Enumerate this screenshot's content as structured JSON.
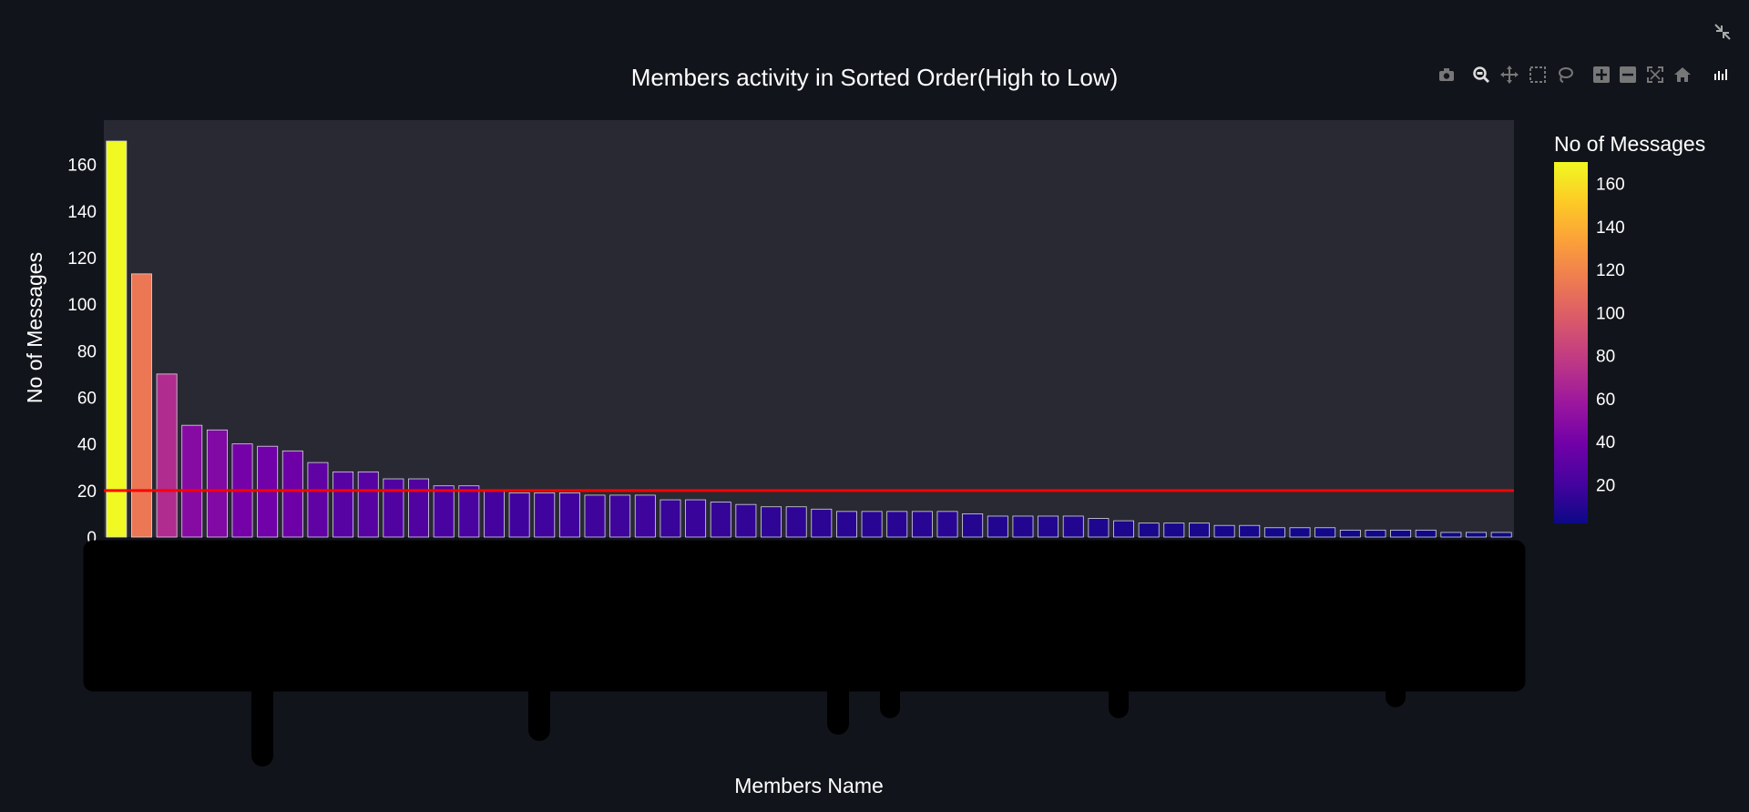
{
  "chart_data": {
    "type": "bar",
    "title": "Members activity in Sorted Order(High to Low)",
    "xlabel": "Members Name",
    "ylabel": "No of Messages",
    "ylim": [
      0,
      170
    ],
    "yticks": [
      0,
      20,
      40,
      60,
      80,
      100,
      120,
      140,
      160
    ],
    "reference_line": 20,
    "reference_line_color": "#ff0000",
    "x_tick_labels_visible": false,
    "values": [
      170,
      113,
      70,
      48,
      46,
      40,
      39,
      37,
      32,
      28,
      28,
      25,
      25,
      22,
      22,
      20,
      19,
      19,
      19,
      18,
      18,
      18,
      16,
      16,
      15,
      14,
      13,
      13,
      12,
      11,
      11,
      11,
      11,
      11,
      10,
      9,
      9,
      9,
      9,
      8,
      7,
      6,
      6,
      6,
      5,
      5,
      4,
      4,
      4,
      3,
      3,
      3,
      3,
      2,
      2,
      2
    ],
    "colorbar": {
      "title": "No of Messages",
      "ticks": [
        20,
        40,
        60,
        80,
        100,
        120,
        140,
        160
      ],
      "colorscale": [
        "#0d0887",
        "#46039f",
        "#7201a8",
        "#9c179e",
        "#bd3786",
        "#d8576b",
        "#ed7953",
        "#fb9f3a",
        "#fdca26",
        "#f0f921"
      ],
      "range": [
        2,
        170
      ]
    },
    "grid": false,
    "legend_position": "right"
  },
  "colors": {
    "page_background": "#11141b",
    "plot_background": "#282933",
    "text": "#ffffff",
    "redaction": "#000000"
  },
  "toolbar": {
    "icons": [
      "camera-icon",
      "zoom-icon",
      "pan-icon",
      "box-select-icon",
      "lasso-icon",
      "zoom-in-icon",
      "zoom-out-icon",
      "autoscale-icon",
      "home-icon",
      "plotly-logo-icon"
    ]
  }
}
